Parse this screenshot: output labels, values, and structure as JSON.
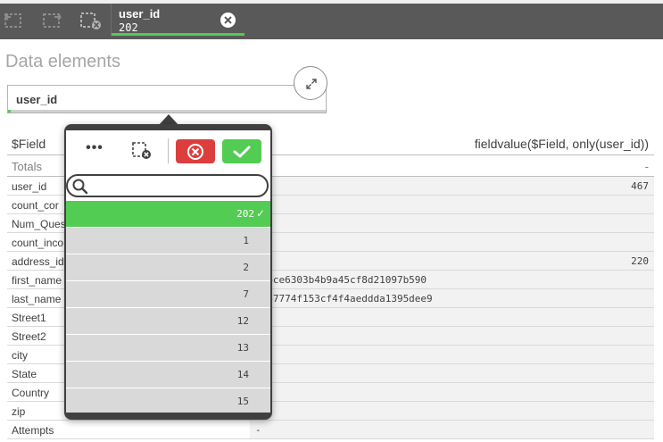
{
  "toolbar": {
    "back_icon": "step-back-icon",
    "forward_icon": "step-forward-icon",
    "clear_all_icon": "clear-all-selections-icon",
    "selection": {
      "field": "user_id",
      "value": "202",
      "clear_icon": "close-circle-icon"
    }
  },
  "panel": {
    "title": "Data elements",
    "filter_label": "user_id",
    "expand_icon": "expand-icon"
  },
  "table": {
    "columns": [
      "$Field",
      "fieldvalue($Field, only(user_id))"
    ],
    "totals": {
      "label": "Totals",
      "value": "-"
    },
    "rows": [
      {
        "field": "user_id",
        "value": "467"
      },
      {
        "field": "count_cor",
        "value": ""
      },
      {
        "field": "Num_Ques",
        "value": ""
      },
      {
        "field": "count_inco",
        "value": ""
      },
      {
        "field": "address_id",
        "value": "220"
      },
      {
        "field": "first_name",
        "value": "09bce6303b4b9a45cf8d21097b590"
      },
      {
        "field": "last_name",
        "value": "7087774f153cf4f4aeddda1395dee9"
      },
      {
        "field": "Street1",
        "value": ""
      },
      {
        "field": "Street2",
        "value": ""
      },
      {
        "field": "city",
        "value": ""
      },
      {
        "field": "State",
        "value": ""
      },
      {
        "field": "Country",
        "value": ""
      },
      {
        "field": "zip",
        "value": ""
      },
      {
        "field": "Attempts",
        "value": "-"
      }
    ]
  },
  "dropdown": {
    "more_label": "•••",
    "clear_selection_icon": "clear-selection-icon",
    "cancel_icon": "cancel-icon",
    "confirm_icon": "checkmark-icon",
    "search_placeholder": "",
    "search_icon": "search-icon",
    "items": [
      {
        "value": "202",
        "selected": true,
        "mark": "✓"
      },
      {
        "value": "1",
        "selected": false
      },
      {
        "value": "2",
        "selected": false
      },
      {
        "value": "7",
        "selected": false
      },
      {
        "value": "12",
        "selected": false
      },
      {
        "value": "13",
        "selected": false
      },
      {
        "value": "14",
        "selected": false
      },
      {
        "value": "15",
        "selected": false
      }
    ]
  },
  "colors": {
    "toolbar_bg": "#595959",
    "selected_green": "#52cc52",
    "cancel_red": "#dc3e3e",
    "popover_bg": "#404040",
    "alt_cell": "#f2f2f2",
    "list_item": "#d9d9d9"
  }
}
